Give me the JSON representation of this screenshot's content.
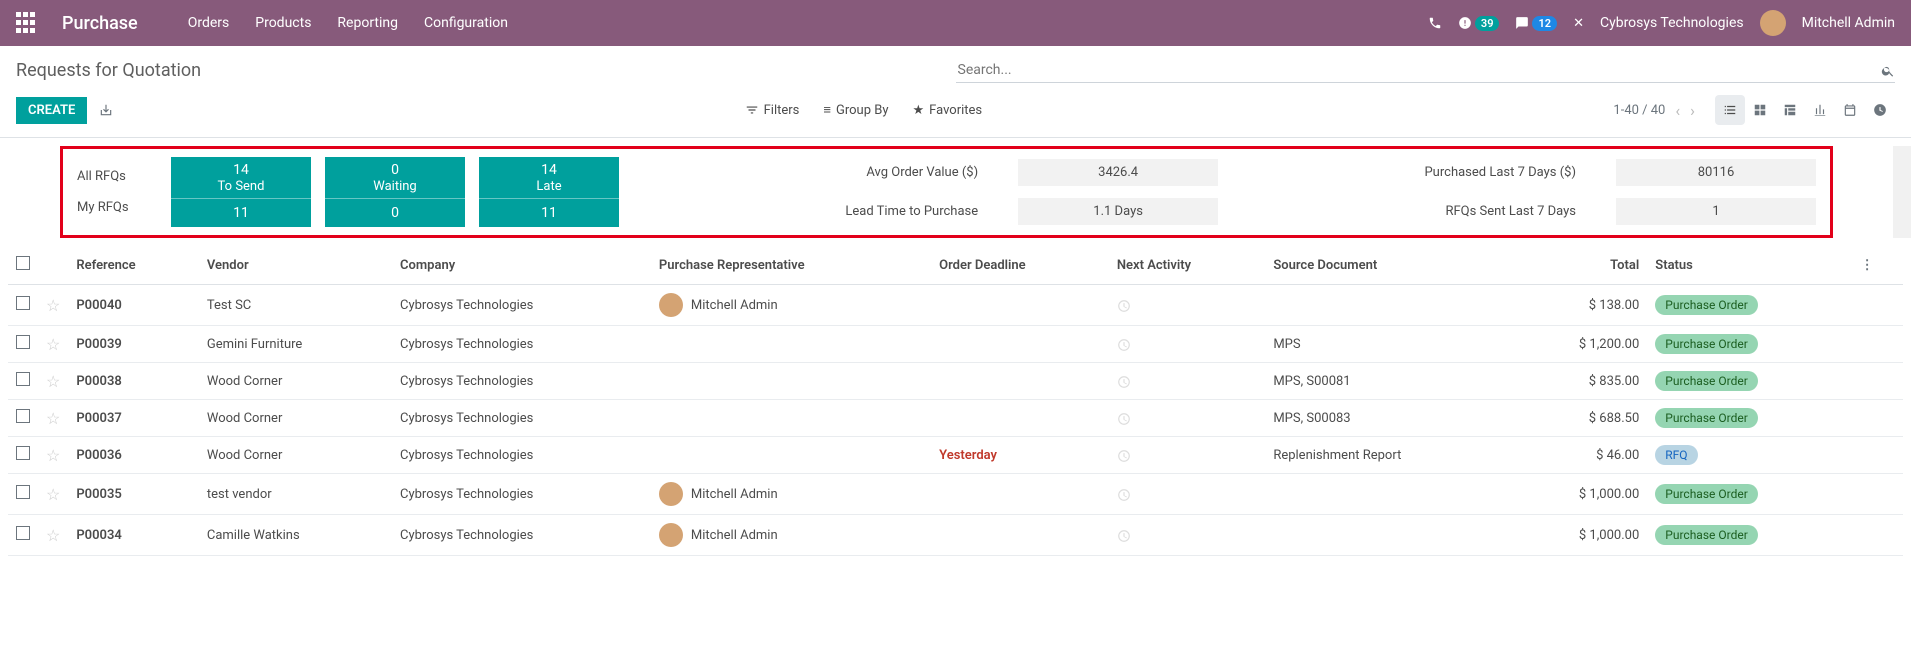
{
  "header": {
    "app_title": "Purchase",
    "nav": [
      "Orders",
      "Products",
      "Reporting",
      "Configuration"
    ],
    "badge_activities": "39",
    "badge_messages": "12",
    "company": "Cybrosys Technologies",
    "user": "Mitchell Admin"
  },
  "page": {
    "title": "Requests for Quotation",
    "search_placeholder": "Search...",
    "create_label": "CREATE",
    "filters_label": "Filters",
    "groupby_label": "Group By",
    "favorites_label": "Favorites",
    "pager": "1-40 / 40"
  },
  "stats": {
    "row_labels": [
      "All RFQs",
      "My RFQs"
    ],
    "pills": [
      {
        "label": "To Send",
        "top": "14",
        "bottom": "11"
      },
      {
        "label": "Waiting",
        "top": "0",
        "bottom": "0"
      },
      {
        "label": "Late",
        "top": "14",
        "bottom": "11"
      }
    ],
    "metrics": [
      {
        "label": "Avg Order Value ($)",
        "value": "3426.4"
      },
      {
        "label": "Purchased Last 7 Days ($)",
        "value": "80116"
      },
      {
        "label": "Lead Time to Purchase",
        "value": "1.1  Days"
      },
      {
        "label": "RFQs Sent Last 7 Days",
        "value": "1"
      }
    ]
  },
  "table": {
    "columns": [
      "Reference",
      "Vendor",
      "Company",
      "Purchase Representative",
      "Order Deadline",
      "Next Activity",
      "Source Document",
      "Total",
      "Status"
    ],
    "rows": [
      {
        "ref": "P00040",
        "vendor": "Test SC",
        "company": "Cybrosys Technologies",
        "rep": "Mitchell Admin",
        "deadline": "",
        "source": "",
        "total": "$ 138.00",
        "status": "Purchase Order",
        "status_class": "po"
      },
      {
        "ref": "P00039",
        "vendor": "Gemini Furniture",
        "company": "Cybrosys Technologies",
        "rep": "",
        "deadline": "",
        "source": "MPS",
        "total": "$ 1,200.00",
        "status": "Purchase Order",
        "status_class": "po"
      },
      {
        "ref": "P00038",
        "vendor": "Wood Corner",
        "company": "Cybrosys Technologies",
        "rep": "",
        "deadline": "",
        "source": "MPS, S00081",
        "total": "$ 835.00",
        "status": "Purchase Order",
        "status_class": "po"
      },
      {
        "ref": "P00037",
        "vendor": "Wood Corner",
        "company": "Cybrosys Technologies",
        "rep": "",
        "deadline": "",
        "source": "MPS, S00083",
        "total": "$ 688.50",
        "status": "Purchase Order",
        "status_class": "po"
      },
      {
        "ref": "P00036",
        "vendor": "Wood Corner",
        "company": "Cybrosys Technologies",
        "rep": "",
        "deadline": "Yesterday",
        "source": "Replenishment Report",
        "total": "$ 46.00",
        "status": "RFQ",
        "status_class": "rfq"
      },
      {
        "ref": "P00035",
        "vendor": "test vendor",
        "company": "Cybrosys Technologies",
        "rep": "Mitchell Admin",
        "deadline": "",
        "source": "",
        "total": "$ 1,000.00",
        "status": "Purchase Order",
        "status_class": "po"
      },
      {
        "ref": "P00034",
        "vendor": "Camille Watkins",
        "company": "Cybrosys Technologies",
        "rep": "Mitchell Admin",
        "deadline": "",
        "source": "",
        "total": "$ 1,000.00",
        "status": "Purchase Order",
        "status_class": "po"
      }
    ]
  }
}
